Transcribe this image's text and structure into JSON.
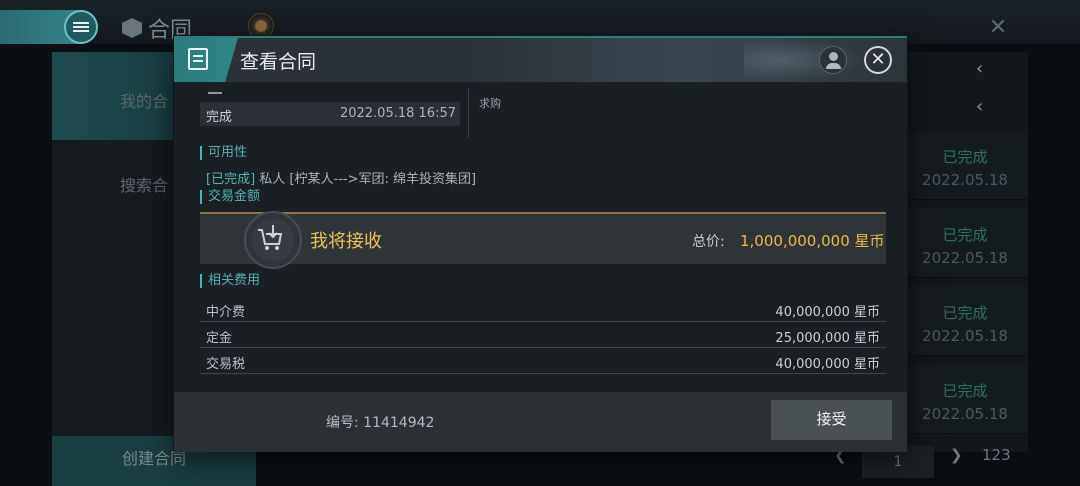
{
  "background": {
    "top_title": "合同",
    "left_nav": [
      "我的合",
      "搜索合"
    ],
    "create_label": "创建合同",
    "rows": [
      {
        "status": "已完成",
        "date": "2022.05.18"
      },
      {
        "status": "已完成",
        "date": "2022.05.18"
      },
      {
        "status": "已完成",
        "date": "2022.05.18"
      },
      {
        "status": "已完成",
        "date": "2022.05.18"
      }
    ],
    "pager": {
      "current": "1",
      "total": "123"
    }
  },
  "modal": {
    "title": "查看合同",
    "status": "完成",
    "status_time": "2022.05.18 16:57",
    "contract_type": "求购",
    "availability_label": "可用性",
    "availability_status": "[已完成]",
    "availability_text": "私人 [柠某人--->军团: 绵羊投资集团]",
    "amount_label": "交易金额",
    "receive_label": "我将接收",
    "total_label": "总价:",
    "total_value": "1,000,000,000 星币",
    "fees_label": "相关费用",
    "fees": [
      {
        "name": "中介费",
        "value": "40,000,000 星币"
      },
      {
        "name": "定金",
        "value": "25,000,000 星币"
      },
      {
        "name": "交易税",
        "value": "40,000,000 星币"
      }
    ],
    "contract_id": "编号: 11414942",
    "accept_label": "接受"
  }
}
